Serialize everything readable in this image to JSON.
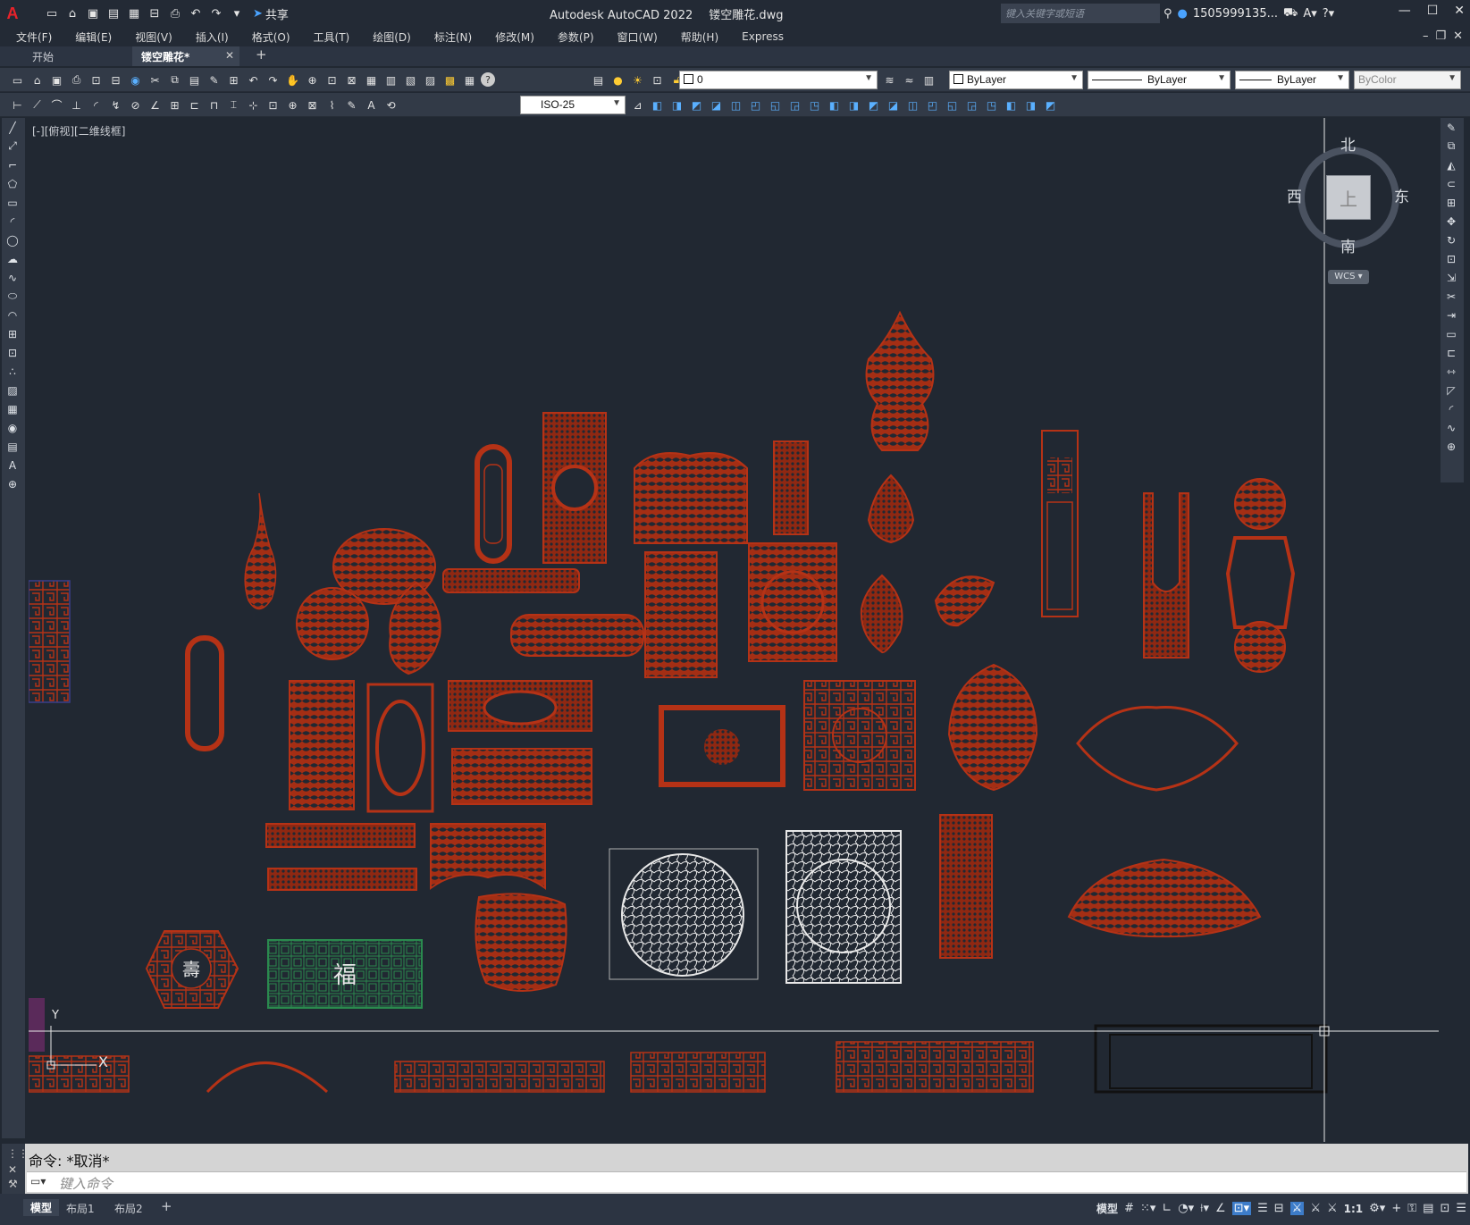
{
  "app": {
    "title": "Autodesk AutoCAD 2022",
    "filename": "镂空雕花.dwg",
    "logo": "A",
    "share_label": "共享",
    "search_placeholder": "键入关键字或短语",
    "username": "1505999135..."
  },
  "menu": [
    "文件(F)",
    "编辑(E)",
    "视图(V)",
    "插入(I)",
    "格式(O)",
    "工具(T)",
    "绘图(D)",
    "标注(N)",
    "修改(M)",
    "参数(P)",
    "窗口(W)",
    "帮助(H)",
    "Express"
  ],
  "tabs": {
    "start": "开始",
    "doc": "镂空雕花*",
    "close": "✕",
    "add": "+"
  },
  "toolbar": {
    "layer_value": "0",
    "color_value": "ByLayer",
    "linetype_value": "ByLayer",
    "lineweight_value": "ByLayer",
    "plotstyle_value": "ByColor",
    "dimstyle_value": "ISO-25"
  },
  "viewport": {
    "label": "[-][俯视][二维线框]",
    "north": "北",
    "south": "南",
    "east": "东",
    "west": "西",
    "top_face": "上",
    "wcs": "WCS",
    "ucs_x": "X",
    "ucs_y": "Y"
  },
  "drawing": {
    "fu_char": "福",
    "shou_char": "壽"
  },
  "command": {
    "history": "命令: *取消*",
    "placeholder": "键入命令"
  },
  "status": {
    "model_tab": "模型",
    "layout1": "布局1",
    "layout2": "布局2",
    "add": "+",
    "model_label": "模型",
    "scale": "1:1"
  },
  "colors": {
    "background": "#212832",
    "carving": "#b53216",
    "carving_fill": "#8f2812",
    "white_lines": "#e8e8e8",
    "green_lines": "#2a8a4e",
    "accent": "#3d7cc9"
  }
}
